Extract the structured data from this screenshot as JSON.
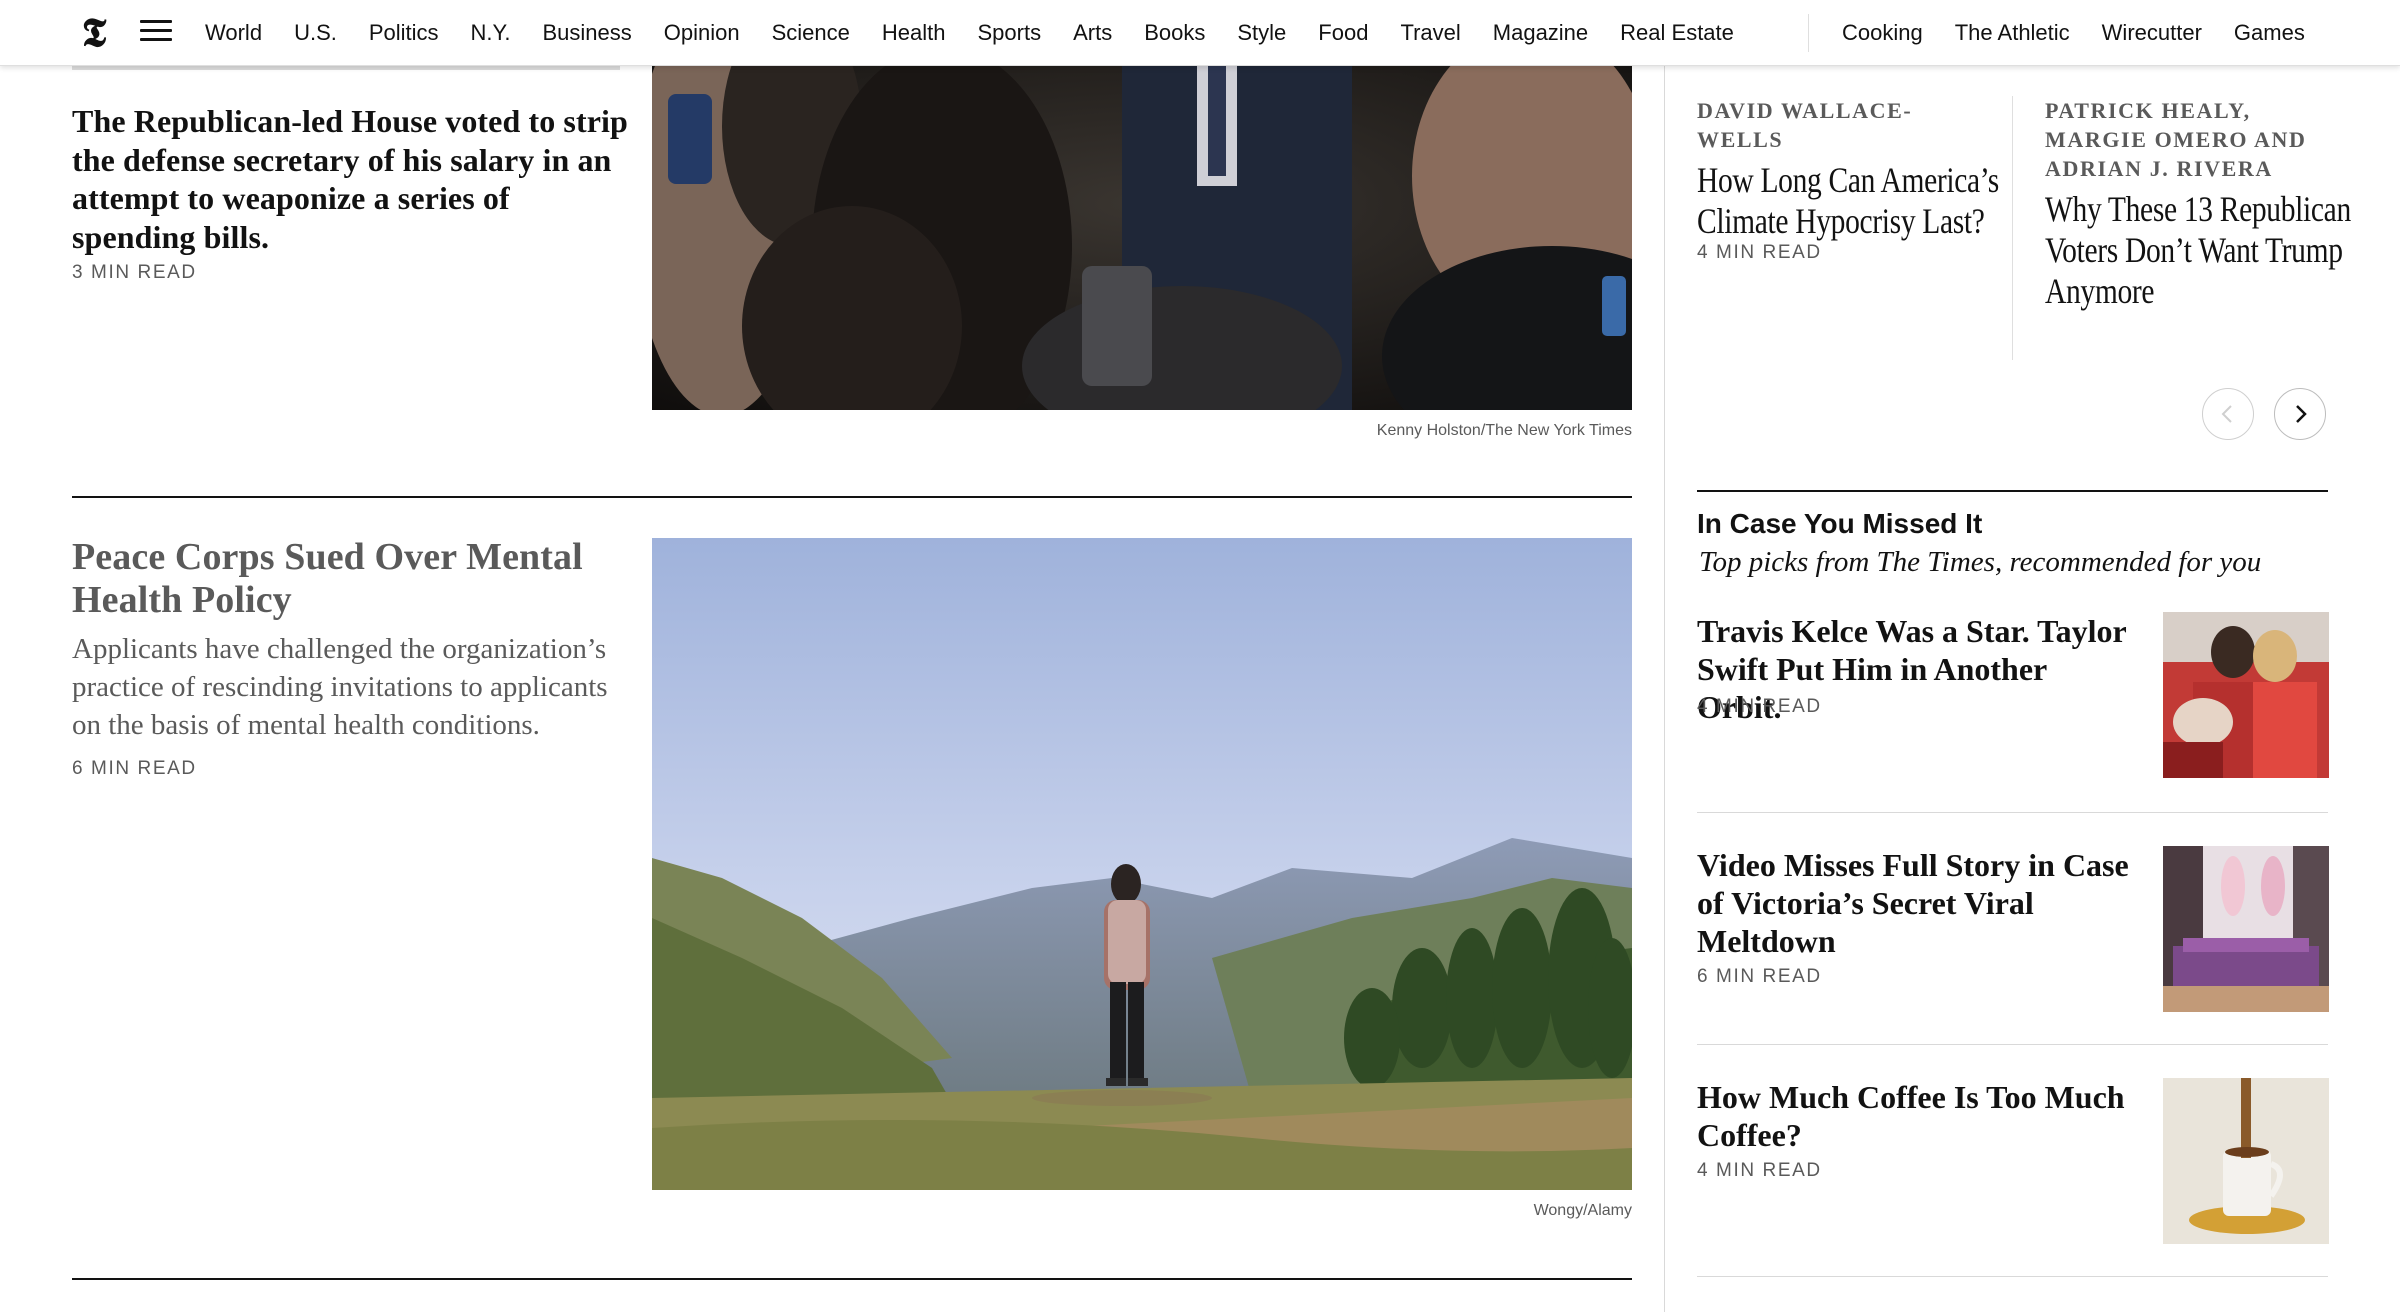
{
  "nav": {
    "sections": [
      "World",
      "U.S.",
      "Politics",
      "N.Y.",
      "Business",
      "Opinion",
      "Science",
      "Health",
      "Sports",
      "Arts",
      "Books",
      "Style",
      "Food",
      "Travel",
      "Magazine",
      "Real Estate"
    ],
    "products": [
      "Cooking",
      "The Athletic",
      "Wirecutter",
      "Games"
    ]
  },
  "stories": [
    {
      "headline": "The Republican-led House voted to strip the defense secretary of his salary in an attempt to weaponize a series of spending bills.",
      "read_time": "3 MIN READ",
      "photo_credit": "Kenny Holston/The New York Times"
    },
    {
      "headline": "Peace Corps Sued Over Mental Health Policy",
      "summary": "Applicants have challenged the organization’s practice of rescinding invitations to applicants on the basis of mental health conditions.",
      "read_time": "6 MIN READ",
      "photo_credit": "Wongy/Alamy"
    }
  ],
  "opinion": [
    {
      "author": "DAVID WALLACE-WELLS",
      "headline": "How Long Can America’s Climate Hypocrisy Last?",
      "read_time": "4 MIN READ"
    },
    {
      "author": "PATRICK HEALY, MARGIE OMERO AND ADRIAN J. RIVERA",
      "headline": "Why These 13 Republican Voters Don’t Want Trump Anymore"
    }
  ],
  "icymi": {
    "title": "In Case You Missed It",
    "subtitle": "Top picks from The Times, recommended for you",
    "items": [
      {
        "headline": "Travis Kelce Was a Star. Taylor Swift Put Him in Another Orbit.",
        "read_time": "4 MIN READ"
      },
      {
        "headline": "Video Misses Full Story in Case of Victoria’s Secret Viral Meltdown",
        "read_time": "6 MIN READ"
      },
      {
        "headline": "How Much Coffee Is Too Much Coffee?",
        "read_time": "4 MIN READ"
      }
    ]
  },
  "icons": {
    "logo": "nyt-logo-icon",
    "menu": "hamburger-menu-icon",
    "prev": "chevron-left-icon",
    "next": "chevron-right-icon"
  }
}
